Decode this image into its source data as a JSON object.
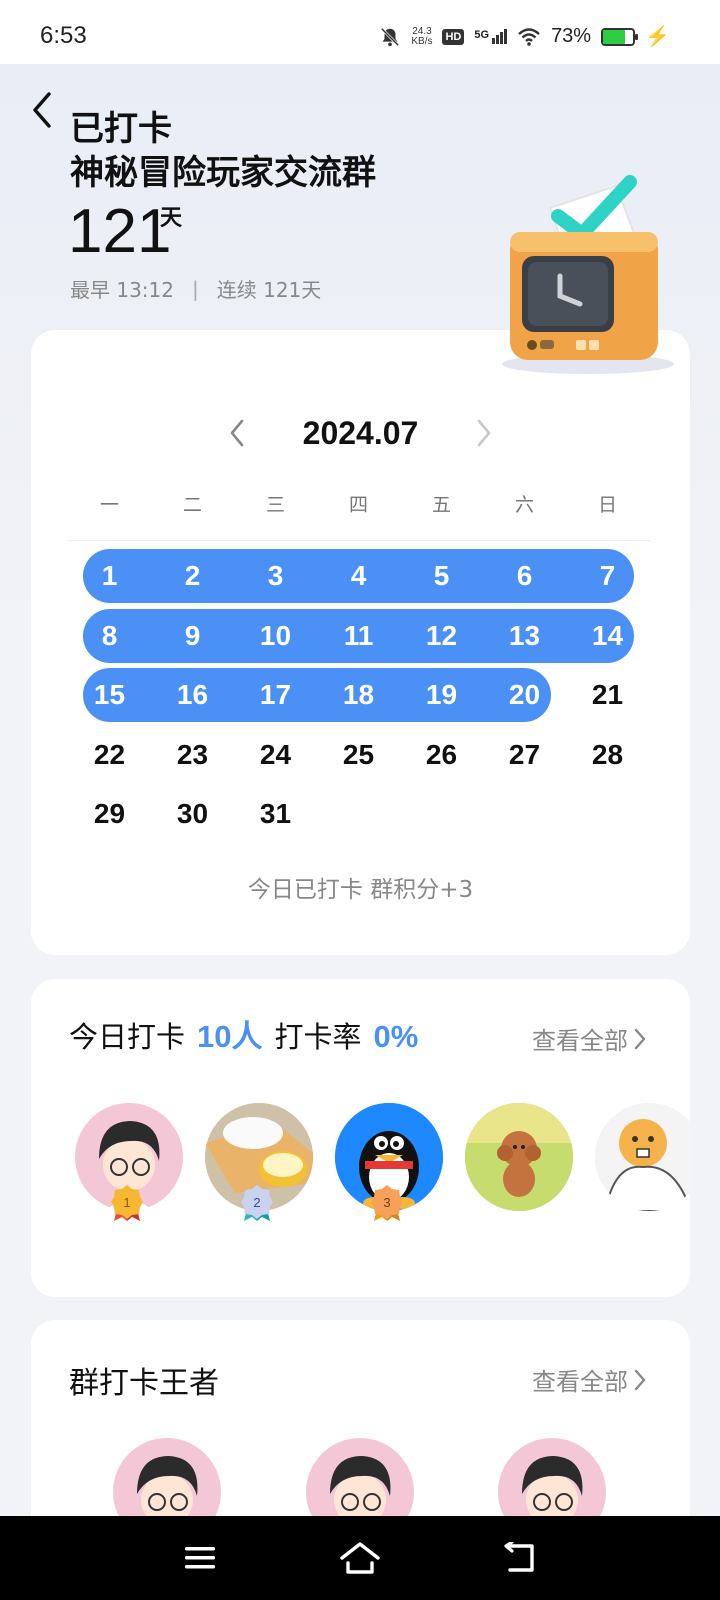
{
  "status_bar": {
    "time": "6:53",
    "net_speed_value": "24.3",
    "net_speed_unit": "KB/s",
    "hd": "HD",
    "signal": "5G",
    "battery": "73%",
    "battery_level": 0.73,
    "icons": [
      "mute-bell-icon",
      "wifi-icon",
      "battery-icon",
      "charging-bolt-icon"
    ]
  },
  "header": {
    "title": "已打卡",
    "group_name": "神秘冒险玩家交流群",
    "days": "121",
    "days_unit": "天",
    "earliest": "最早 13:12",
    "separator": "|",
    "streak": "连续 121天"
  },
  "calendar": {
    "month": "2024.07",
    "weekdays": [
      "一",
      "二",
      "三",
      "四",
      "五",
      "六",
      "日"
    ],
    "days": [
      "1",
      "2",
      "3",
      "4",
      "5",
      "6",
      "7",
      "8",
      "9",
      "10",
      "11",
      "12",
      "13",
      "14",
      "15",
      "16",
      "17",
      "18",
      "19",
      "20",
      "21",
      "22",
      "23",
      "24",
      "25",
      "26",
      "27",
      "28",
      "29",
      "30",
      "31"
    ],
    "checked_days": [
      1,
      2,
      3,
      4,
      5,
      6,
      7,
      8,
      9,
      10,
      11,
      12,
      13,
      14,
      15,
      16,
      17,
      18,
      19,
      20
    ],
    "first_weekday_index": 0,
    "today_status": "今日已打卡  群积分+3",
    "accent_color": "#4a90f5"
  },
  "today_checkin": {
    "label": "今日打卡",
    "count": "10人",
    "rate_label": "打卡率",
    "rate": "0%",
    "view_all": "查看全部",
    "medals": [
      "1",
      "2",
      "3"
    ]
  },
  "kings": {
    "title": "群打卡王者",
    "view_all": "查看全部"
  }
}
